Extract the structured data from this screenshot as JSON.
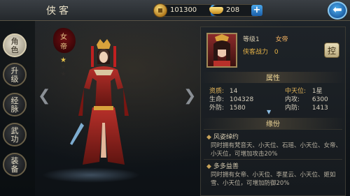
{
  "header": {
    "title": "侠客",
    "copper": "101300",
    "gold": "208"
  },
  "tabs": [
    {
      "l1": "角",
      "l2": "色"
    },
    {
      "l1": "升",
      "l2": "级"
    },
    {
      "l1": "经",
      "l2": "脉"
    },
    {
      "l1": "武",
      "l2": "功"
    },
    {
      "l1": "装",
      "l2": "备"
    }
  ],
  "badge": {
    "l1": "女",
    "l2": "帝"
  },
  "hero": {
    "level_label": "等级1",
    "name": "女帝",
    "power_label": "侠客战力",
    "power": "0",
    "action_button": "控"
  },
  "attributes": {
    "header": "属性",
    "rows": [
      {
        "k1": "资质:",
        "v1": "14",
        "k2": "中天位:",
        "v2": "1星",
        "hi": true
      },
      {
        "k1": "生命:",
        "v1": "104328",
        "k2": "内攻:",
        "v2": "6300"
      },
      {
        "k1": "外防:",
        "v1": "1580",
        "k2": "内防:",
        "v2": "1413"
      }
    ]
  },
  "fate": {
    "header": "缘份",
    "items": [
      {
        "title": "风姿绰约",
        "desc": "同时拥有梵音天、小天位、石瑶、小天位、女帝、小天位，可增加攻击20%"
      },
      {
        "title": "多多益善",
        "desc": "同时拥有女帝、小天位、李星云、小天位、姬如雪、小天位，可增加防御20%"
      }
    ]
  },
  "icons": {
    "copper": "copper-coin-icon",
    "gold": "gold-ingot-icon",
    "add": "plus-icon",
    "back": "back-arrow-icon"
  },
  "colors": {
    "accent_blue": "#2a7fd0",
    "gold_text": "#e6b347",
    "badge_red": "#6d0f12"
  }
}
